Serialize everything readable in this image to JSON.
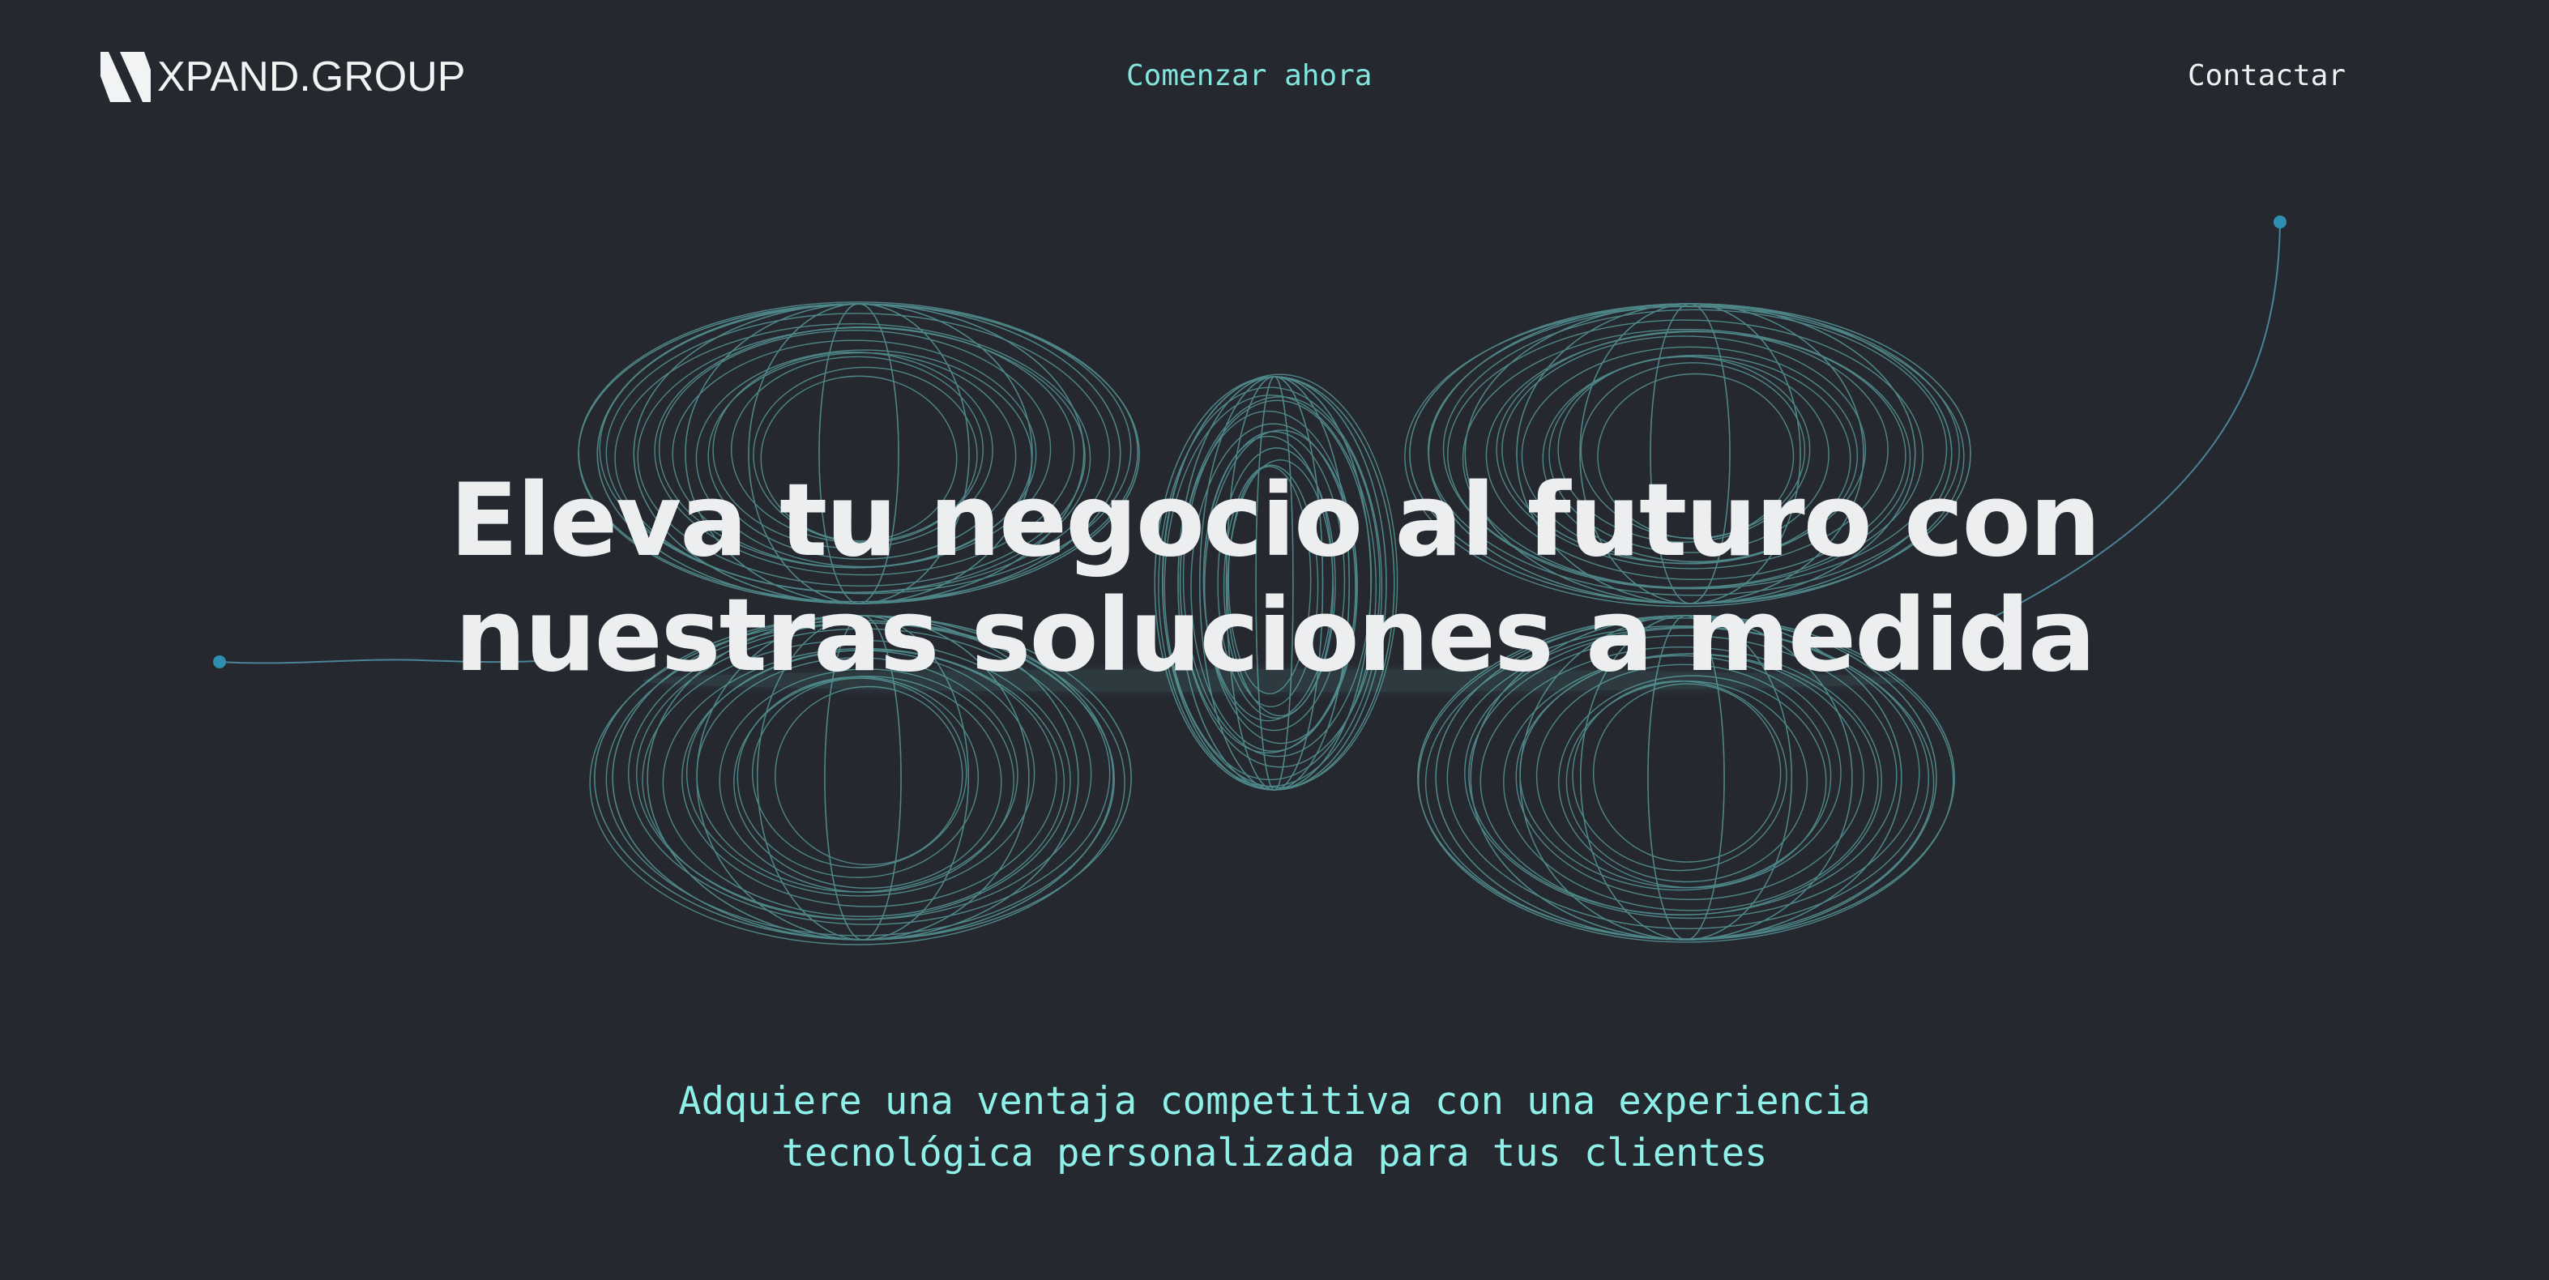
{
  "header": {
    "logo_text": "XPAND.GROUP",
    "nav_start_label": "Comenzar ahora",
    "nav_contact_label": "Contactar"
  },
  "hero": {
    "title_line_1": "Eleva tu negocio al futuro con",
    "title_line_2": "nuestras soluciones a medida",
    "subtitle_line_1": "Adquiere una ventaja competitiva con una experiencia",
    "subtitle_line_2": "tecnológica personalizada para tus clientes"
  },
  "colors": {
    "background": "#262830",
    "accent": "#82e6df",
    "wireframe": "#6fd3cf",
    "dot": "#2f8fb0",
    "text": "#eceef0"
  },
  "icons": {
    "logo": "xpand-logo-mark-icon"
  }
}
